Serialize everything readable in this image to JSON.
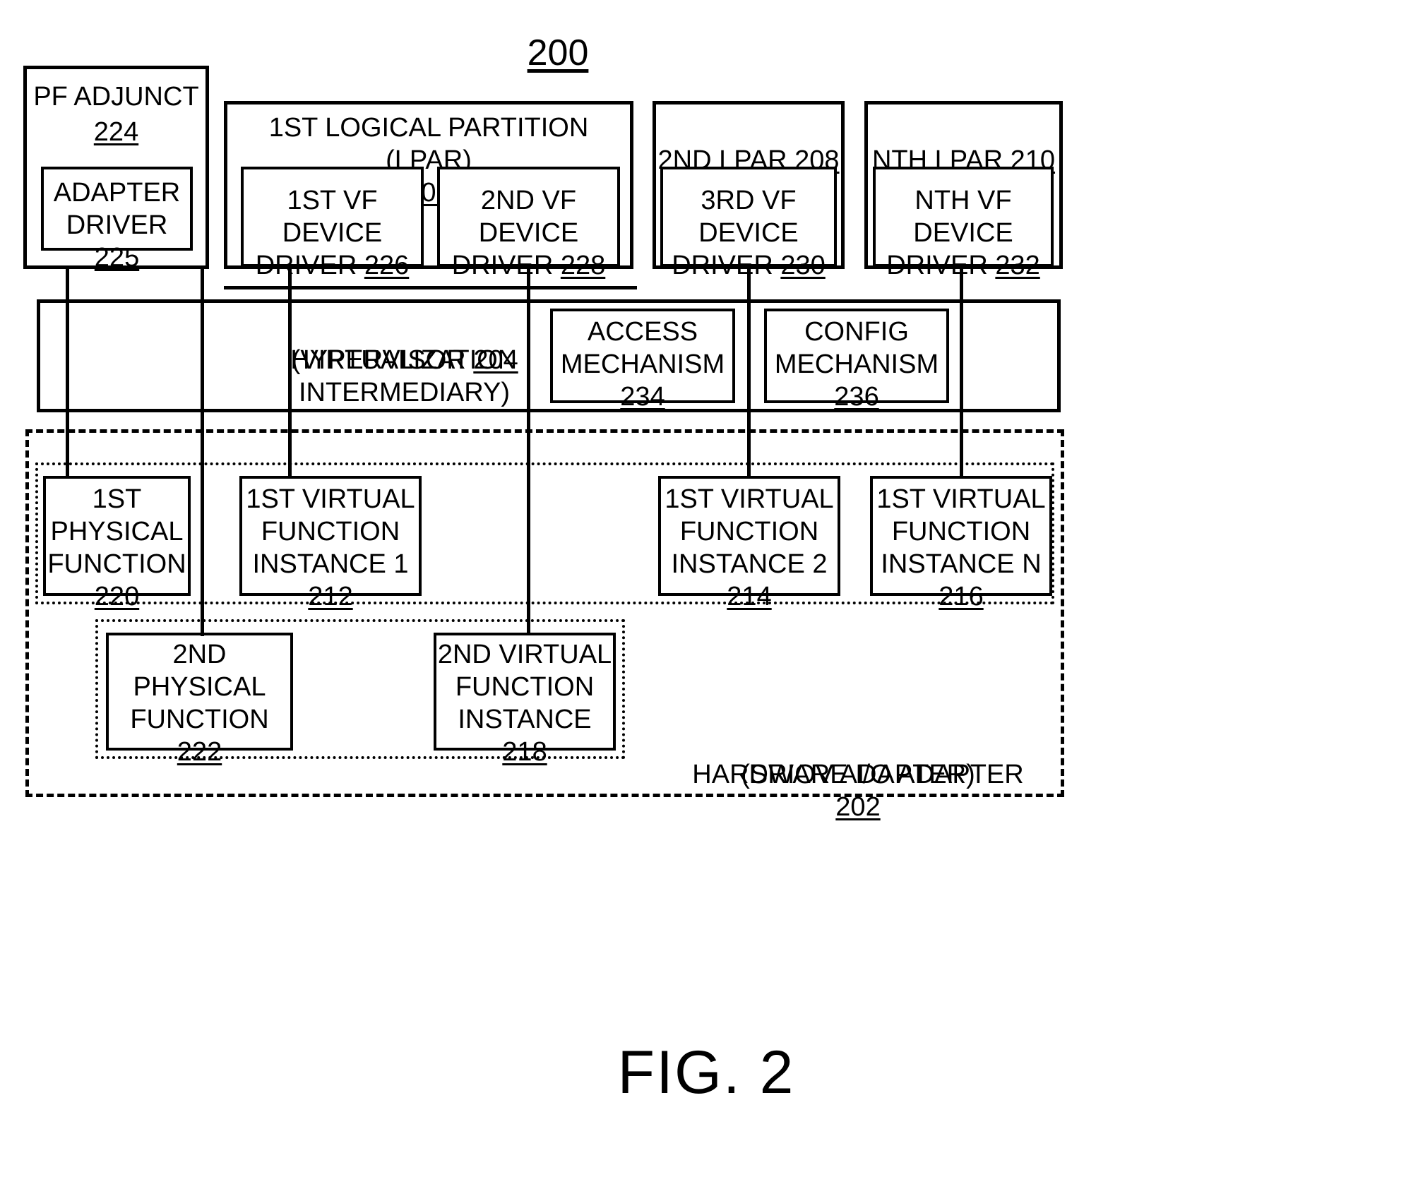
{
  "figure": {
    "number": "200",
    "caption": "FIG. 2"
  },
  "pf_adjunct": {
    "title": "PF ADJUNCT",
    "ref": "224",
    "adapter_driver": {
      "label": "ADAPTER\nDRIVER ",
      "ref": "225"
    }
  },
  "lpars": [
    {
      "title": "1ST LOGICAL PARTITION (LPAR)",
      "ref": "206",
      "drivers": [
        {
          "label": "1ST VF\nDEVICE\nDRIVER ",
          "ref": "226"
        },
        {
          "label": "2ND VF\nDEVICE\nDRIVER ",
          "ref": "228"
        }
      ]
    },
    {
      "title": "2ND LPAR ",
      "ref": "208",
      "drivers": [
        {
          "label": "3RD VF\nDEVICE\nDRIVER ",
          "ref": "230"
        }
      ]
    },
    {
      "title": "NTH LPAR ",
      "ref": "210",
      "drivers": [
        {
          "label": "NTH VF\nDEVICE\nDRIVER ",
          "ref": "232"
        }
      ]
    }
  ],
  "hypervisor": {
    "title": "HYPERVISOR ",
    "ref": "204",
    "subtitle": "(VIRTUALIZATION\nINTERMEDIARY)",
    "mechanisms": [
      {
        "label": "ACCESS\nMECHANISM",
        "ref": "234"
      },
      {
        "label": "CONFIG\nMECHANISM",
        "ref": "236"
      }
    ]
  },
  "hardware_adapter": {
    "label": "HARDWARE I/O ADAPTER ",
    "ref": "202",
    "subtitle": "(SRIOV ADAPTER)",
    "group_one": [
      {
        "label": "1ST\nPHYSICAL\nFUNCTION",
        "ref": "220"
      },
      {
        "label": "1ST VIRTUAL\nFUNCTION\nINSTANCE 1",
        "ref": "212"
      },
      {
        "label": "1ST VIRTUAL\nFUNCTION\nINSTANCE 2",
        "ref": "214"
      },
      {
        "label": "1ST VIRTUAL\nFUNCTION\nINSTANCE N",
        "ref": "216"
      }
    ],
    "group_two": [
      {
        "label": "2ND\nPHYSICAL\nFUNCTION",
        "ref": "222"
      },
      {
        "label": "2ND VIRTUAL\nFUNCTION\nINSTANCE",
        "ref": "218"
      }
    ]
  }
}
